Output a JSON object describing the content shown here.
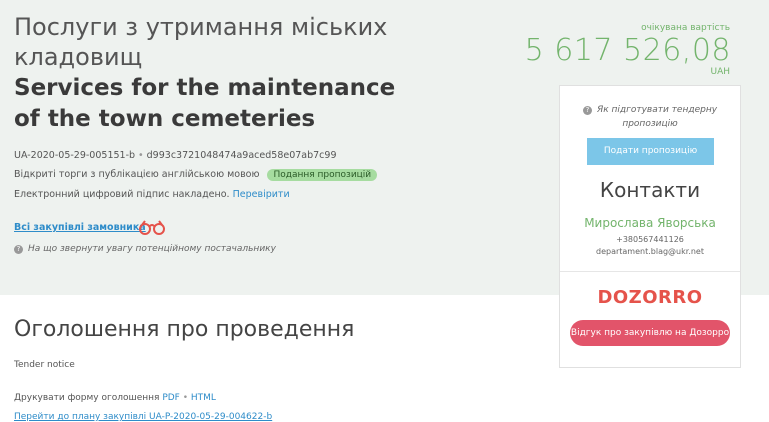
{
  "tender": {
    "title_uk": "Послуги з утримання міських кладовищ",
    "title_en": "Services for the maintenance of the town cemeteries",
    "id": "UA-2020-05-29-005151-b",
    "hash": "d993c3721048474a9aced58e07ab7c99",
    "procedure": "Відкриті торги з публікацією англійською мовою",
    "status_badge": "Подання пропозицій",
    "signature_text": "Електронний цифровий підпис накладено.",
    "verify_link": "Перевірити",
    "all_purchases_link": "Всі закупівлі замовника",
    "attention_hint": "На що звернути увагу потенційному постачальнику"
  },
  "price": {
    "label": "очікувана вартість",
    "amount": "5 617 526,08",
    "currency": "UAH"
  },
  "sidebar": {
    "prepare_hint": "Як підготувати тендерну пропозицію",
    "submit_button": "Подати пропозицію",
    "contacts_title": "Контакти",
    "contact_name": "Мирослава Яворська",
    "phone": "+380567441126",
    "email": "departament.blag@ukr.net",
    "dozorro_logo": "DOZORRO",
    "dozorro_button": "Відгук про закупівлю на Дозорро"
  },
  "notice": {
    "heading": "Оголошення про проведення",
    "subheading": "Tender notice",
    "print_label": "Друкувати форму оголошення",
    "pdf_link": "PDF",
    "html_link": "HTML",
    "plan_link": "Перейти до плану закупівлі UA-P-2020-05-29-004622-b"
  },
  "icons": {
    "question": "question-circle-icon",
    "binoculars": "binoculars-icon"
  },
  "colors": {
    "hero_bg": "#eef2ef",
    "price_green": "#73b46c",
    "link_blue": "#2e8cc9",
    "submit_blue": "#7cc6e8",
    "dozorro_red": "#e2546a"
  }
}
